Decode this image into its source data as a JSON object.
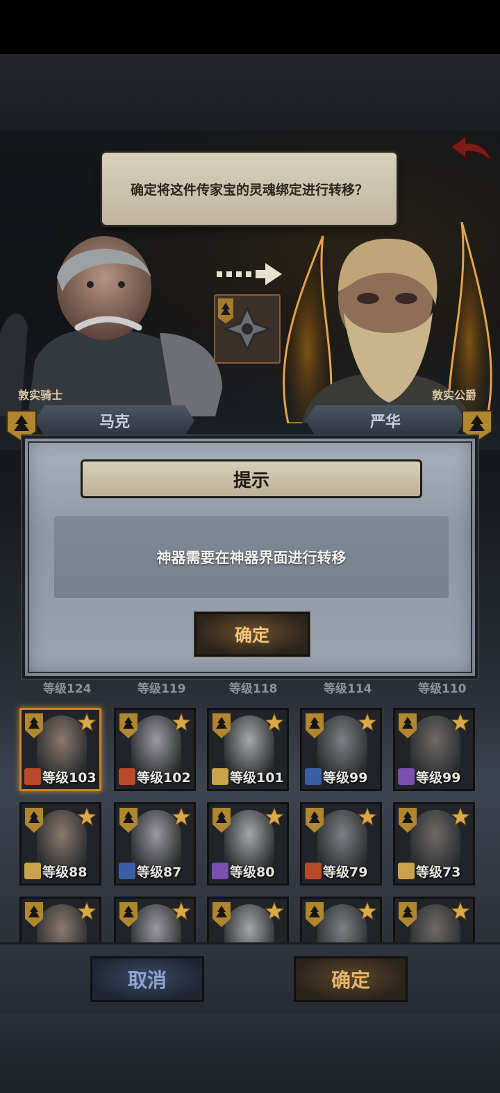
{
  "question": "确定将这件传家宝的灵魂绑定进行转移？",
  "left_character": {
    "title": "敦实骑士",
    "name": "马克"
  },
  "right_character": {
    "title": "敦实公爵",
    "name": "严华"
  },
  "modal": {
    "title": "提示",
    "message": "神器需要在神器界面进行转移",
    "confirm_label": "确定"
  },
  "roster": {
    "strip_levels": [
      "等级124",
      "等级119",
      "等级118",
      "等级114",
      "等级110"
    ],
    "rows": [
      [
        "等级103",
        "等级102",
        "等级101",
        "等级99",
        "等级99"
      ],
      [
        "等级88",
        "等级87",
        "等级80",
        "等级79",
        "等级73"
      ]
    ]
  },
  "footer": {
    "cancel_label": "取消",
    "confirm_label": "确定"
  },
  "colors": {
    "accent_gold": "#f3c47a",
    "cancel_blue": "#8ea6cf",
    "selected_border": "#c7832c"
  }
}
